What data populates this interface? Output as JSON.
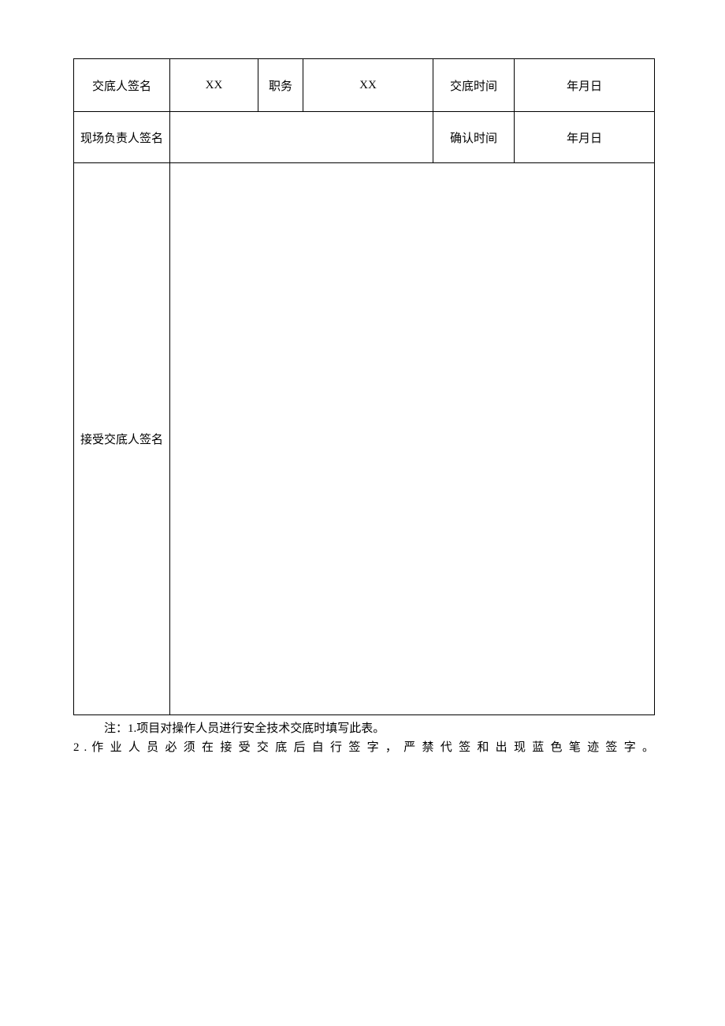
{
  "table": {
    "row1": {
      "c1": "交底人签名",
      "c2": "XX",
      "c3": "职务",
      "c4": "XX",
      "c5": "交底时间",
      "c6": "年月日"
    },
    "row2": {
      "c1": "现场负责人签名",
      "c2": "",
      "c5": "确认时间",
      "c6": "年月日"
    },
    "row3": {
      "c1": "接受交底人签名",
      "c2": ""
    }
  },
  "notes": {
    "n1": "注：1.项目对操作人员进行安全技术交底时填写此表。",
    "n2": "2 . 作 业 人 员 必 须 在 接 受 交 底 后 自 行 签 字 ， 严 禁 代 签 和 出 现 蓝 色 笔 迹 签 字 。"
  }
}
